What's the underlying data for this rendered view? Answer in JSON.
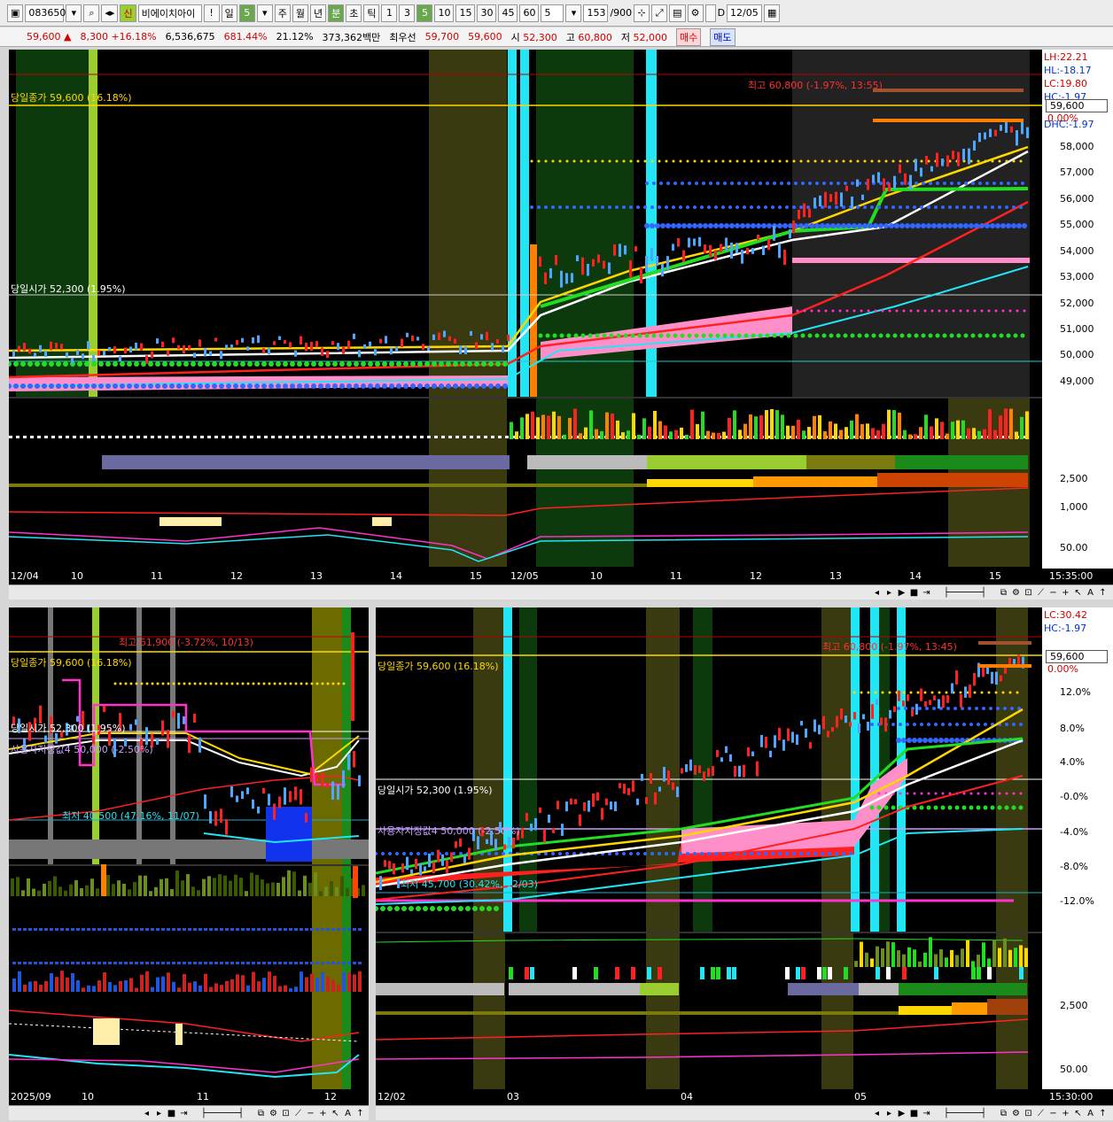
{
  "toolbar": {
    "code": "083650",
    "tag": "신",
    "name": "비에이치아이",
    "bang": "!",
    "period_day": "일",
    "period_val": "5",
    "week": "주",
    "month": "월",
    "year": "년",
    "minute": "분",
    "second": "초",
    "tick": "틱",
    "intervals": [
      "1",
      "3",
      "5",
      "10",
      "15",
      "30",
      "45",
      "60"
    ],
    "custom_val": "5",
    "count": "153",
    "count_max": "/900",
    "d_label": "D",
    "date": "12/05"
  },
  "quote": {
    "price": "59,600",
    "arrow": "▲",
    "change": "8,300",
    "change_pct": "+16.18%",
    "volume": "6,536,675",
    "vol_ratio": "681.44%",
    "turnover": "21.12%",
    "amount": "373,362백만",
    "best_ask_label": "최우선",
    "best_ask": "59,700",
    "best_bid": "59,600",
    "open_label": "시",
    "open": "52,300",
    "high_label": "고",
    "high": "60,800",
    "low_label": "저",
    "low": "52,000",
    "buy": "매수",
    "sell": "매도"
  },
  "top_chart": {
    "close_label": "당일종가 59,600 (16.18%)",
    "open_label": "당일시가 52,300 (1.95%)",
    "high_label": "최고 60,800 (-1.97%, 13:55)",
    "lh": "LH:22.21",
    "hl": "HL:-18.17",
    "lc": "LC:19.80",
    "hc": "HC:-1.97",
    "dhc": "DHC:-1.97",
    "price_box": "59,600",
    "pct_box": "0.00%",
    "y_ticks": [
      "58,000",
      "57,000",
      "56,000",
      "55,000",
      "54,000",
      "53,000",
      "52,000",
      "51,000",
      "50,000",
      "49,000"
    ],
    "sub_ticks": [
      "2,500",
      "1,000",
      "50.00"
    ],
    "x_ticks": [
      "12/04",
      "10",
      "11",
      "12",
      "13",
      "14",
      "15",
      "12/05",
      "10",
      "11",
      "12",
      "13",
      "14",
      "15"
    ],
    "time": "15:35:00"
  },
  "bl_chart": {
    "high_label": "최고 61,900 (-3.72%, 10/13)",
    "close_label": "당일종가 59,600 (16.18%)",
    "open_label": "당일시가 52,300 (1.95%)",
    "user_label": "사용자지정값4 50,000 (-2.50%)",
    "low_label": "최저 40,500 (47.16%, 11/07)",
    "x_ticks": [
      "2025/09",
      "10",
      "11",
      "12"
    ]
  },
  "br_chart": {
    "high_label": "최고 60,800 (-1.97%, 13:45)",
    "close_label": "당일종가 59,600 (16.18%)",
    "open_label": "당일시가 52,300 (1.95%)",
    "user_label": "사용자지정값4 50,000 (-2.50%)",
    "low_label": "최저 45,700 (30.42%, 12/03)",
    "lc": "LC:30.42",
    "hc": "HC:-1.97",
    "price_box": "59,600",
    "pct_box": "0.00%",
    "y_ticks": [
      "12.0%",
      "8.0%",
      "4.0%",
      "-0.0%",
      "-4.0%",
      "-8.0%",
      "-12.0%"
    ],
    "sub_ticks": [
      "2,500",
      "50.00"
    ],
    "x_ticks": [
      "12/02",
      "03",
      "04",
      "05"
    ],
    "time": "15:30:00"
  },
  "colors": {
    "up": "#ff2020",
    "down": "#4da6ff",
    "cyan": "#22e5f5",
    "pink": "#ff8fc8",
    "green": "#22dd22",
    "yellow": "#ffd700",
    "olive": "#7a7a10",
    "darkgreen": "#0c3a0c"
  }
}
